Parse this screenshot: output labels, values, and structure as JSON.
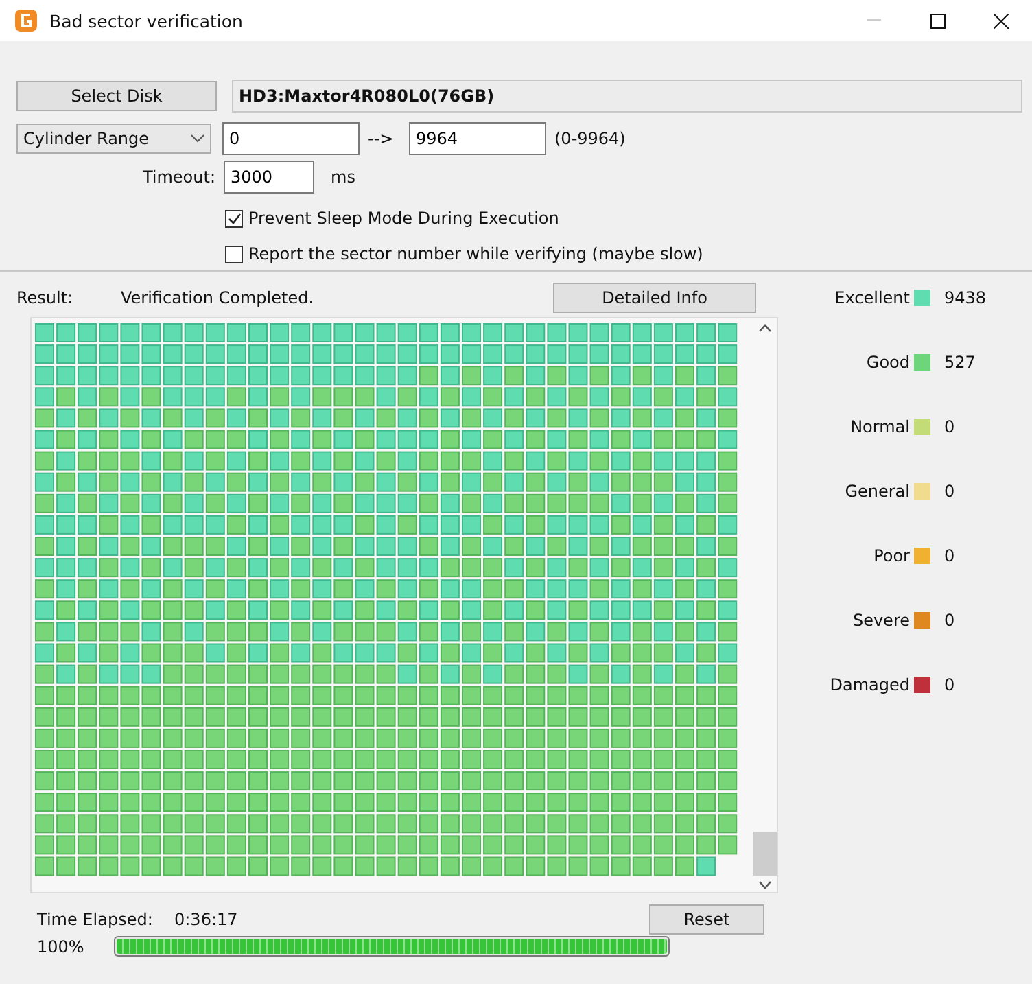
{
  "window": {
    "title": "Bad sector verification"
  },
  "select_disk_button": "Select Disk",
  "disk": "HD3:Maxtor4R080L0(76GB)",
  "range": {
    "mode": "Cylinder Range",
    "from": "0",
    "arrow": "-->",
    "to": "9964",
    "limits": "(0-9964)"
  },
  "timeout": {
    "label": "Timeout:",
    "value": "3000",
    "unit": "ms"
  },
  "options": [
    {
      "label": "Prevent Sleep Mode During Execution",
      "checked": true
    },
    {
      "label": "Report the sector number while verifying (maybe slow)",
      "checked": false
    }
  ],
  "result": {
    "label": "Result:",
    "value": "Verification Completed."
  },
  "detail_button": "Detailed Info",
  "legend": [
    {
      "label": "Excellent",
      "color": "#5fdcb0",
      "count": "9438"
    },
    {
      "label": "Good",
      "color": "#6dd57a",
      "count": "527"
    },
    {
      "label": "Normal",
      "color": "#c4dc78",
      "count": "0"
    },
    {
      "label": "General",
      "color": "#f0dc8c",
      "count": "0"
    },
    {
      "label": "Poor",
      "color": "#f0b030",
      "count": "0"
    },
    {
      "label": "Severe",
      "color": "#e08820",
      "count": "0"
    },
    {
      "label": "Damaged",
      "color": "#c0303c",
      "count": "0"
    }
  ],
  "time": {
    "label": "Time Elapsed:",
    "value": "0:36:17"
  },
  "reset_button": "Reset",
  "progress": {
    "percent": "100%",
    "level": 1
  }
}
